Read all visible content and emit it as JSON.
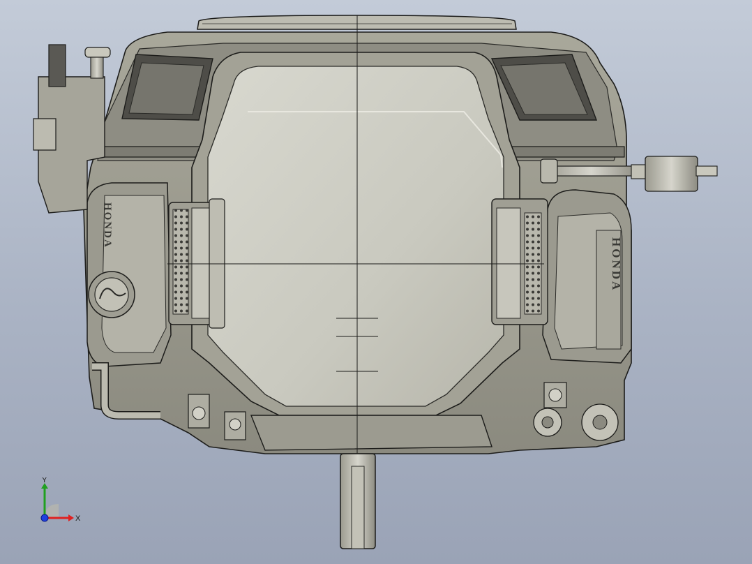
{
  "viewport": {
    "brand_left": "HONDA",
    "brand_right": "HONDA"
  },
  "triad": {
    "x_label": "X",
    "y_label": "Y",
    "x_color": "#e02020",
    "y_color": "#20a020",
    "z_color": "#2040e0"
  },
  "colors": {
    "background_top": "#c3cbd8",
    "background_bottom": "#9aa3b6",
    "metal": "#c4c3b7",
    "metal_dark": "#6f6e66",
    "edge": "#1c1c1a"
  }
}
